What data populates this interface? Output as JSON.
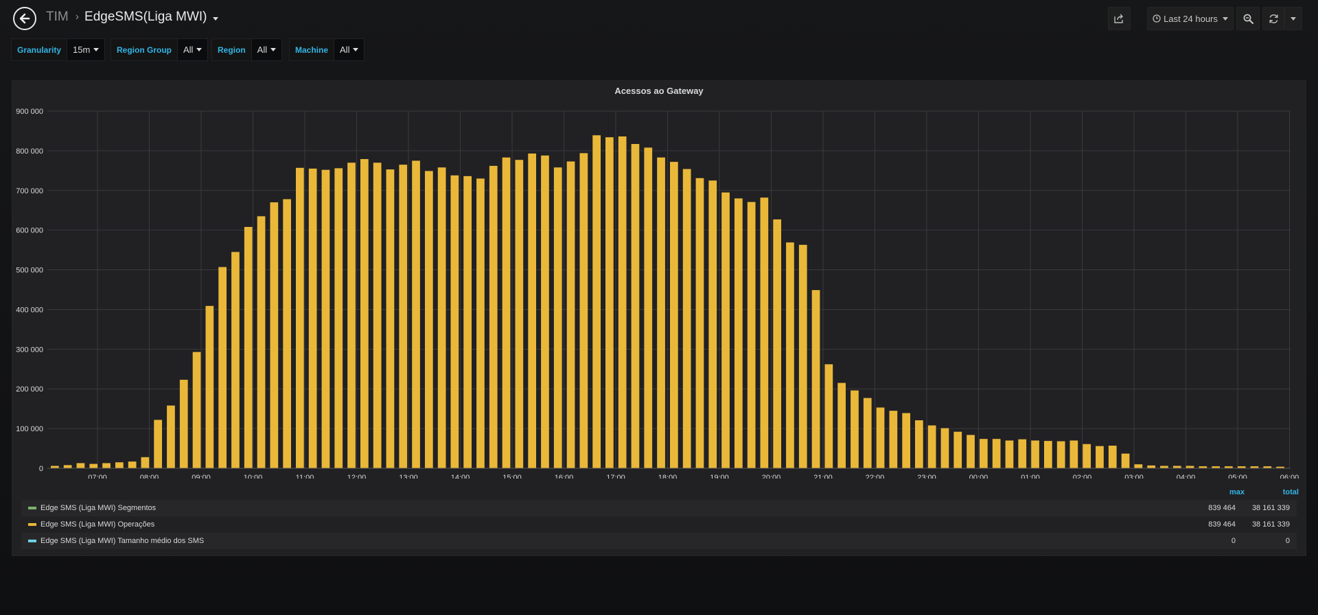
{
  "header": {
    "folder": "TIM",
    "title": "EdgeSMS(Liga MWI)",
    "time_range": "Last 24 hours",
    "icons": [
      "back-arrow-icon",
      "share-icon",
      "clock-icon",
      "zoom-out-icon",
      "refresh-icon"
    ]
  },
  "variables": [
    {
      "label": "Granularity",
      "value": "15m"
    },
    {
      "label": "Region Group",
      "value": "All"
    },
    {
      "label": "Region",
      "value": "All"
    },
    {
      "label": "Machine",
      "value": "All"
    }
  ],
  "panel": {
    "title": "Acessos ao Gateway",
    "legend_headers": {
      "max": "max",
      "total": "total"
    },
    "legend": [
      {
        "name": "Edge SMS (Liga MWI) Segmentos",
        "color": "#7eb26d",
        "max": "839 464",
        "total": "38 161 339"
      },
      {
        "name": "Edge SMS (Liga MWI) Operações",
        "color": "#eab839",
        "max": "839 464",
        "total": "38 161 339"
      },
      {
        "name": "Edge SMS (Liga MWI) Tamanho médio dos SMS",
        "color": "#6ed0e0",
        "max": "0",
        "total": "0"
      }
    ]
  },
  "chart_data": {
    "type": "bar",
    "title": "Acessos ao Gateway",
    "color": "#eab839",
    "ylim": [
      0,
      900000
    ],
    "y_ticks": [
      "0",
      "100 000",
      "200 000",
      "300 000",
      "400 000",
      "500 000",
      "600 000",
      "700 000",
      "800 000",
      "900 000"
    ],
    "x_ticks": [
      "07:00",
      "08:00",
      "09:00",
      "10:00",
      "11:00",
      "12:00",
      "13:00",
      "14:00",
      "15:00",
      "16:00",
      "17:00",
      "18:00",
      "19:00",
      "20:00",
      "21:00",
      "22:00",
      "23:00",
      "00:00",
      "01:00",
      "02:00",
      "03:00",
      "04:00",
      "05:00",
      "06:00"
    ],
    "grid": true,
    "series": [
      {
        "name": "Edge SMS (Liga MWI) Operações",
        "values": [
          6000,
          8000,
          13000,
          11000,
          13000,
          15000,
          17000,
          28000,
          122000,
          158000,
          223000,
          293000,
          409000,
          507000,
          545000,
          608000,
          635000,
          670000,
          678000,
          757000,
          755000,
          752000,
          756000,
          770000,
          779000,
          770000,
          753000,
          765000,
          775000,
          749000,
          758000,
          738000,
          736000,
          730000,
          762000,
          783000,
          777000,
          793000,
          788000,
          758000,
          773000,
          794000,
          839000,
          834000,
          836000,
          817000,
          808000,
          783000,
          772000,
          754000,
          731000,
          725000,
          695000,
          680000,
          671000,
          682000,
          627000,
          569000,
          563000,
          449000,
          262000,
          215000,
          196000,
          177000,
          153000,
          145000,
          139000,
          121000,
          108000,
          101000,
          92000,
          84000,
          74000,
          74000,
          70000,
          73000,
          70000,
          69000,
          68000,
          70000,
          61000,
          56000,
          57000,
          37000,
          10000,
          7000,
          6000,
          6000,
          6000,
          5000,
          5000,
          5000,
          5000,
          5000,
          5000,
          4000
        ]
      }
    ]
  }
}
